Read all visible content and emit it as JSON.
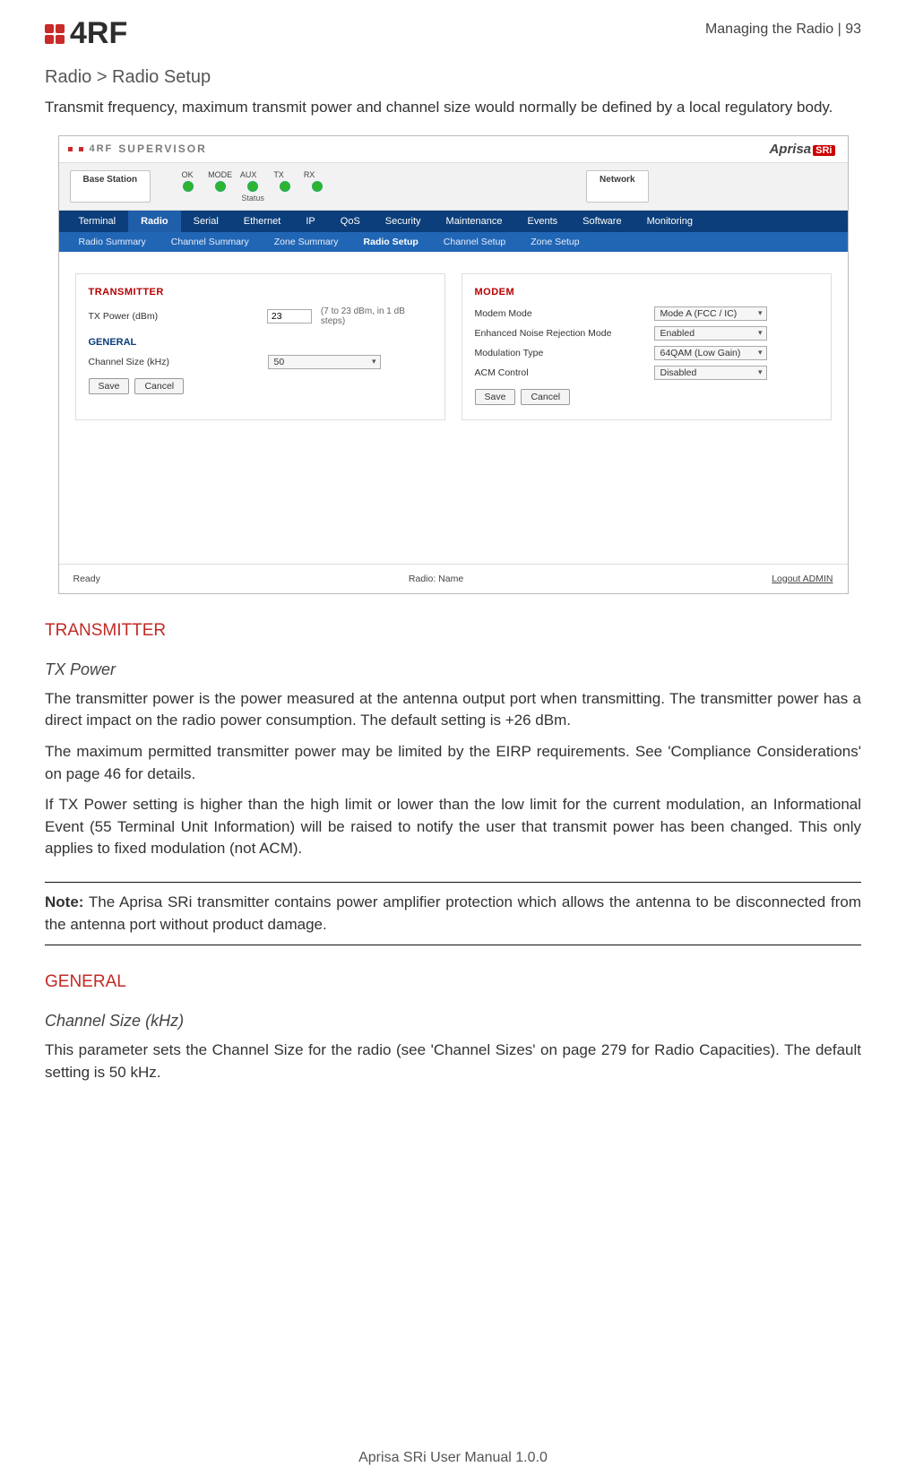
{
  "header": {
    "brand": "4RF",
    "page_header": "Managing the Radio  |  93",
    "breadcrumb": "Radio > Radio Setup",
    "intro": "Transmit frequency, maximum transmit power and channel size would normally be defined by a local regulatory body."
  },
  "screenshot": {
    "supervisor": "SUPERVISOR",
    "brand_right": "Aprisa",
    "brand_right_badge": "SRi",
    "tab_base": "Base Station",
    "tab_network": "Network",
    "led_labels": [
      "OK",
      "MODE",
      "AUX",
      "TX",
      "RX"
    ],
    "status_label": "Status",
    "nav1": [
      "Terminal",
      "Radio",
      "Serial",
      "Ethernet",
      "IP",
      "QoS",
      "Security",
      "Maintenance",
      "Events",
      "Software",
      "Monitoring"
    ],
    "nav1_active": "Radio",
    "nav2": [
      "Radio Summary",
      "Channel Summary",
      "Zone Summary",
      "Radio Setup",
      "Channel Setup",
      "Zone Setup"
    ],
    "nav2_active": "Radio Setup",
    "left_panel": {
      "title": "TRANSMITTER",
      "tx_power_label": "TX Power (dBm)",
      "tx_power_value": "23",
      "tx_power_range": "(7 to 23 dBm, in 1 dB steps)",
      "sub": "GENERAL",
      "ch_label": "Channel Size (kHz)",
      "ch_value": "50",
      "save": "Save",
      "cancel": "Cancel"
    },
    "right_panel": {
      "title": "MODEM",
      "rows": [
        {
          "label": "Modem Mode",
          "value": "Mode A (FCC / IC)"
        },
        {
          "label": "Enhanced Noise Rejection Mode",
          "value": "Enabled"
        },
        {
          "label": "Modulation Type",
          "value": "64QAM (Low Gain)"
        },
        {
          "label": "ACM Control",
          "value": "Disabled"
        }
      ],
      "save": "Save",
      "cancel": "Cancel"
    },
    "footer": {
      "ready": "Ready",
      "radio": "Radio: Name",
      "logout": "Logout ADMIN"
    }
  },
  "sections": {
    "transmitter": "TRANSMITTER",
    "tx_power_h": "TX Power",
    "tx1": "The transmitter power is the power measured at the antenna output port when transmitting. The transmitter power has a direct impact on the radio power consumption. The default setting is +26 dBm.",
    "tx2": "The maximum permitted transmitter power may be limited by the EIRP requirements. See 'Compliance Considerations' on page 46 for details.",
    "tx3": "If TX Power setting is higher than the high limit or lower than the low limit for the current modulation, an Informational Event (55 Terminal Unit Information) will be raised to notify the user that transmit power has been changed. This only applies to fixed modulation (not ACM).",
    "note": "Note: The Aprisa SRi transmitter contains power amplifier protection which allows the antenna to be disconnected from the antenna port without product damage.",
    "general": "GENERAL",
    "ch_h": "Channel Size (kHz)",
    "ch_txt": "This parameter sets the Channel Size for the radio (see 'Channel Sizes' on page 279 for Radio Capacities). The default setting is 50 kHz."
  },
  "footer": "Aprisa SRi User Manual 1.0.0"
}
